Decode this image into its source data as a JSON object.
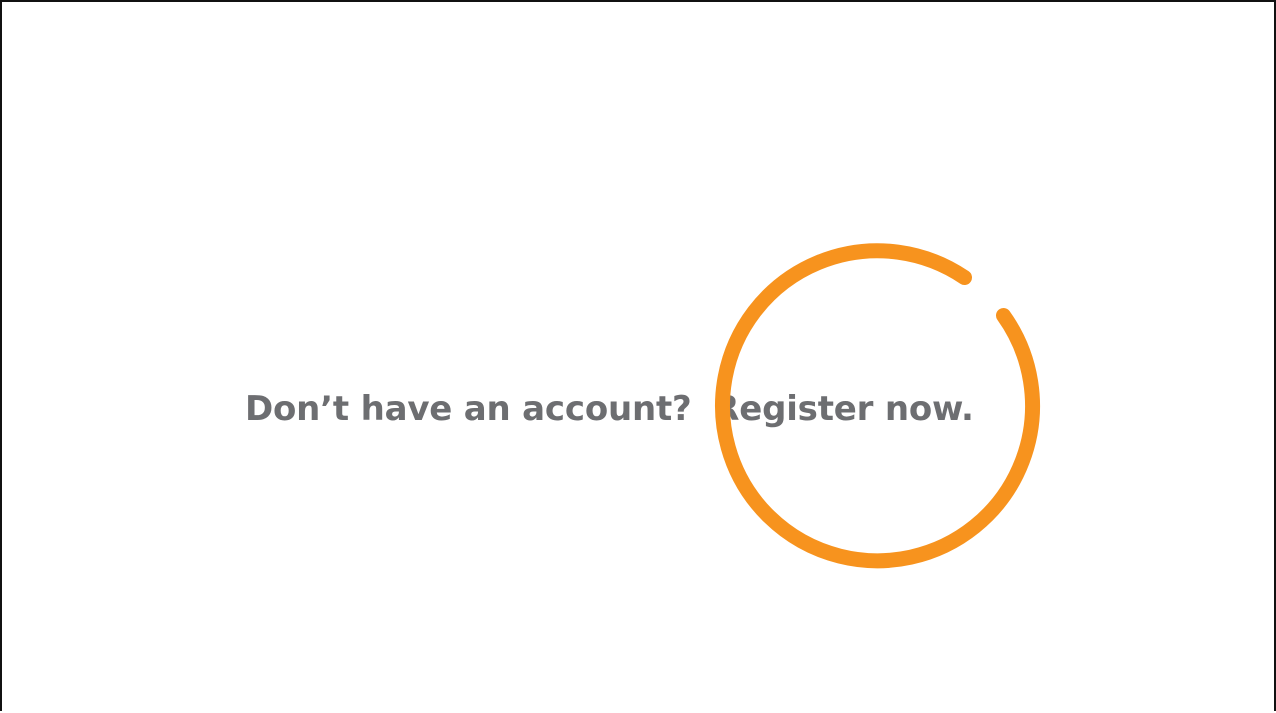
{
  "register_prompt": {
    "question": "Don’t have an account?",
    "link_label": "Register now."
  },
  "colors": {
    "text": "#6d6e71",
    "highlight": "#f7931e",
    "background": "#ffffff"
  },
  "highlight": {
    "icon": "circle-highlight-icon",
    "target": "register-now-link"
  }
}
